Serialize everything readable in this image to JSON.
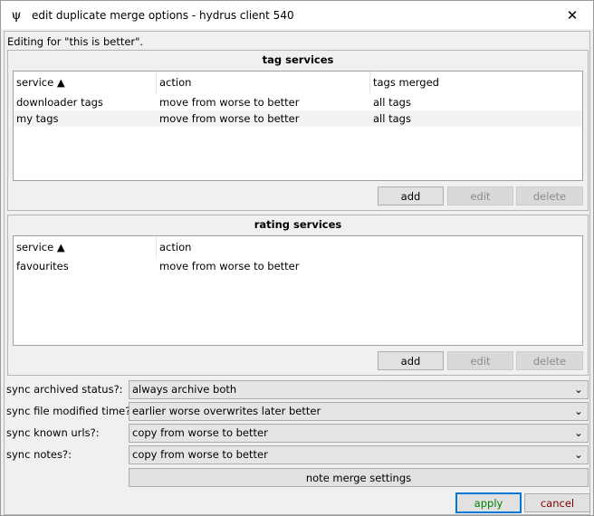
{
  "window": {
    "title": "edit duplicate merge options - hydrus client 540",
    "app_icon_glyph": "ψ",
    "close_glyph": "✕"
  },
  "editing_label": "Editing for \"this is better\".",
  "tag_services": {
    "title": "tag services",
    "columns": [
      "service ▲",
      "action",
      "tags merged"
    ],
    "rows": [
      [
        "downloader tags",
        "move from worse to better",
        "all tags"
      ],
      [
        "my tags",
        "move from worse to better",
        "all tags"
      ]
    ],
    "buttons": {
      "add": "add",
      "edit": "edit",
      "delete": "delete"
    }
  },
  "rating_services": {
    "title": "rating services",
    "columns": [
      "service ▲",
      "action"
    ],
    "rows": [
      [
        "favourites",
        "move from worse to better"
      ]
    ],
    "buttons": {
      "add": "add",
      "edit": "edit",
      "delete": "delete"
    }
  },
  "sync": {
    "archived": {
      "label": "sync archived status?:",
      "value": "always archive both"
    },
    "modified": {
      "label": "sync file modified time?:",
      "value": "earlier worse overwrites later better"
    },
    "urls": {
      "label": "sync known urls?:",
      "value": "copy from worse to better"
    },
    "notes": {
      "label": "sync notes?:",
      "value": "copy from worse to better"
    },
    "dropdown_icon": "chevron-down-icon",
    "chevron_glyph": "⌄"
  },
  "note_merge_button": "note merge settings",
  "footer": {
    "apply": "apply",
    "cancel": "cancel"
  },
  "colors": {
    "apply_text": "#008000",
    "cancel_text": "#800000",
    "focus_border": "#0078d7"
  }
}
